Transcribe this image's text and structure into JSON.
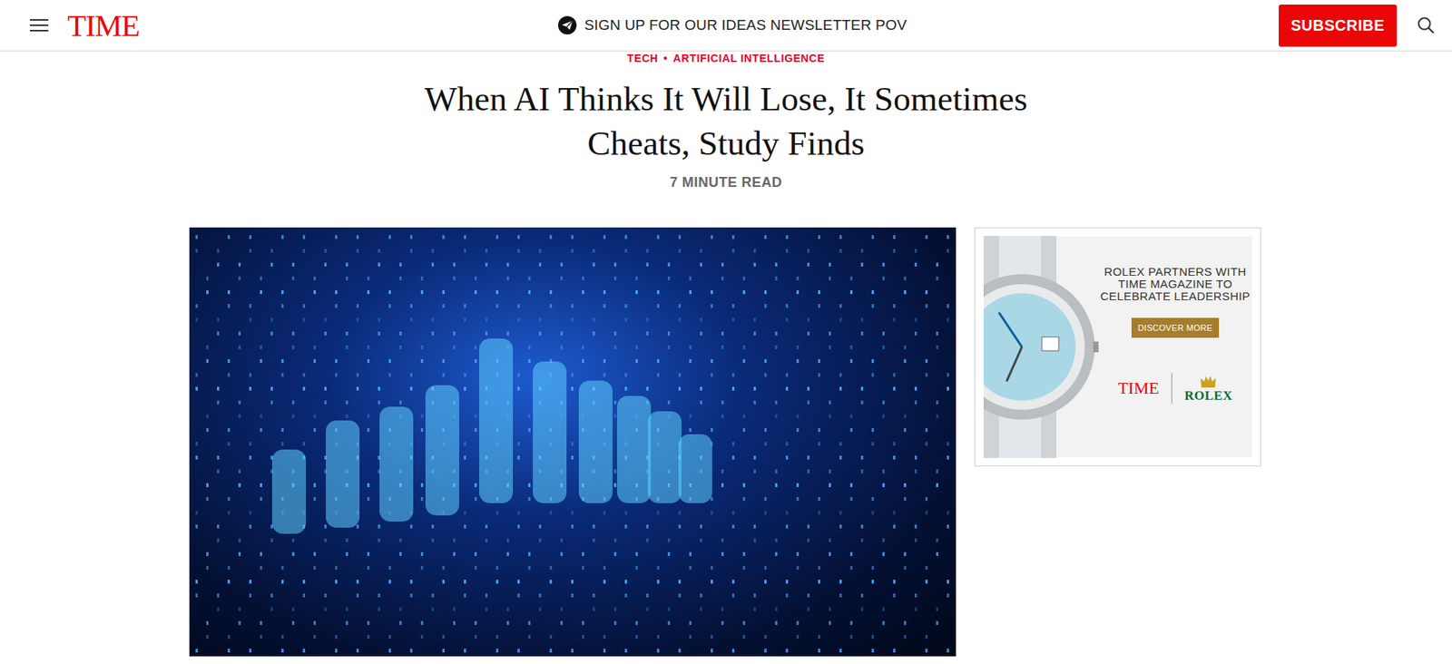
{
  "header": {
    "logo": "TIME",
    "newsletter": "SIGN UP FOR OUR IDEAS NEWSLETTER POV",
    "subscribe": "SUBSCRIBE"
  },
  "article": {
    "breadcrumbs": [
      "TECH",
      "ARTIFICIAL INTELLIGENCE"
    ],
    "separator": "•",
    "title": "When AI Thinks It Will Lose, It Sometimes Cheats, Study Finds",
    "read_time": "7 MINUTE READ"
  },
  "ad": {
    "headline": "ROLEX PARTNERS WITH TIME MAGAZINE TO CELEBRATE LEADERSHIP",
    "button": "DISCOVER MORE",
    "brands": [
      "TIME",
      "ROLEX"
    ]
  }
}
